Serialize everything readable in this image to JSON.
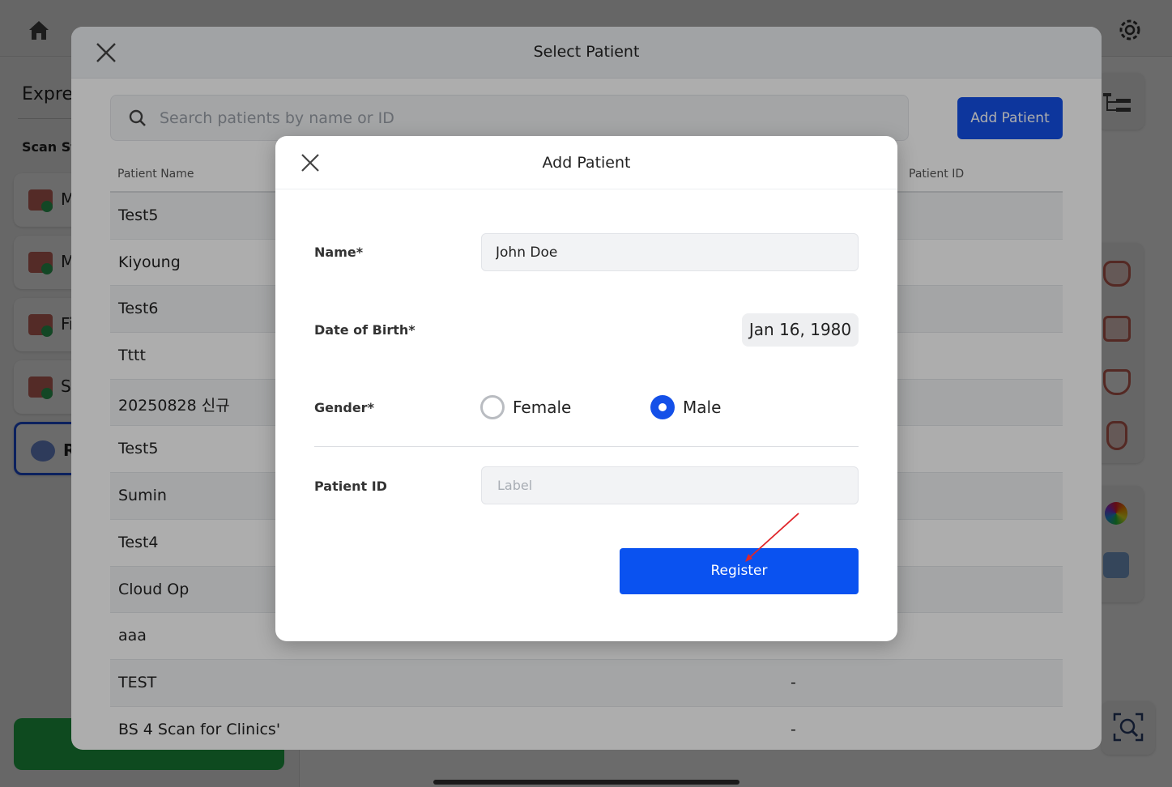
{
  "background": {
    "left_panel": {
      "title": "Expres",
      "subtitle": "Scan St",
      "stages": [
        "M",
        "M",
        "Fi",
        "Sc",
        "R"
      ]
    }
  },
  "select_patient": {
    "title": "Select Patient",
    "search_placeholder": "Search patients by name or ID",
    "add_patient_label": "Add Patient",
    "columns": {
      "name": "Patient Name",
      "id": "Patient ID"
    },
    "rows": [
      {
        "name": "Test5",
        "id": ""
      },
      {
        "name": "Kiyoung",
        "id": ""
      },
      {
        "name": "Test6",
        "id": ""
      },
      {
        "name": "Tttt",
        "id": ""
      },
      {
        "name": "20250828 신규",
        "id": ""
      },
      {
        "name": "Test5",
        "id": ""
      },
      {
        "name": "Sumin",
        "id": ""
      },
      {
        "name": "Test4",
        "id": ""
      },
      {
        "name": "Cloud Op",
        "id": ""
      },
      {
        "name": "aaa",
        "id": ""
      },
      {
        "name": "TEST",
        "id": "-"
      },
      {
        "name": "BS  4  Scan for Clinics'",
        "id": "-"
      }
    ]
  },
  "add_patient": {
    "title": "Add Patient",
    "name_label": "Name*",
    "name_value": "John Doe",
    "dob_label": "Date of Birth*",
    "dob_value": "Jan 16, 1980",
    "gender_label": "Gender*",
    "gender_options": [
      "Female",
      "Male"
    ],
    "gender_selected": "Male",
    "patient_id_label": "Patient ID",
    "patient_id_placeholder": "Label",
    "patient_id_value": "",
    "register_label": "Register"
  },
  "colors": {
    "primary": "#1450e8",
    "register": "#0a52f0",
    "annotation_arrow": "#e0262b",
    "stage_ok": "#2eaa5a",
    "scan_button": "#23b14d"
  }
}
